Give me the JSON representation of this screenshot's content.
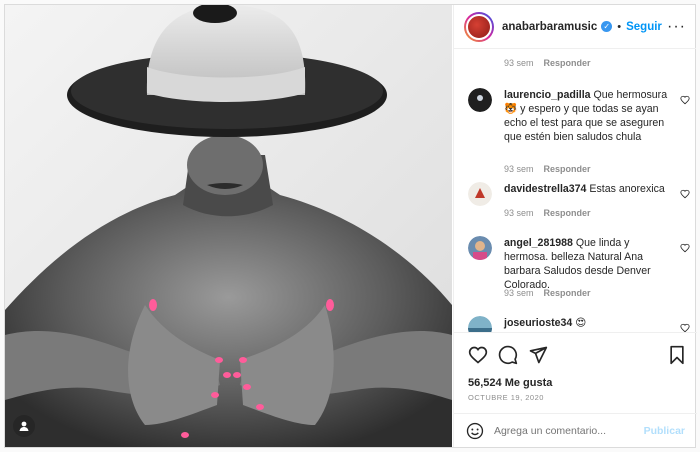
{
  "header": {
    "username": "anabarbaramusic",
    "follow_label": "Seguir",
    "separator": "•",
    "more": "···"
  },
  "first_meta": {
    "time": "93 sem",
    "reply": "Responder"
  },
  "comments": [
    {
      "user": "laurencio_padilla",
      "text": "Que hermosura 🐯 y espero y que todas se ayan echo el test para que se aseguren que estén bien saludos chula",
      "time": "93 sem",
      "reply": "Responder"
    },
    {
      "user": "davidestrella374",
      "text": "Estas anorexica",
      "time": "93 sem",
      "reply": "Responder"
    },
    {
      "user": "angel_281988",
      "text": "Que linda y hermosa. belleza Natural Ana barbara Saludos desde Denver Colorado.",
      "time": "93 sem",
      "reply": "Responder"
    },
    {
      "user": "joseurioste34",
      "text": "😍",
      "time": "",
      "reply": ""
    }
  ],
  "likes": "56,524 Me gusta",
  "date": "OCTUBRE 19, 2020",
  "add_comment": {
    "placeholder": "Agrega un comentario...",
    "publish_label": "Publicar"
  },
  "icons": {
    "user_tag": "user-tag-icon",
    "heart": "heart-icon",
    "comment": "comment-icon",
    "share": "share-icon",
    "save": "bookmark-icon",
    "emoji": "emoji-icon"
  }
}
